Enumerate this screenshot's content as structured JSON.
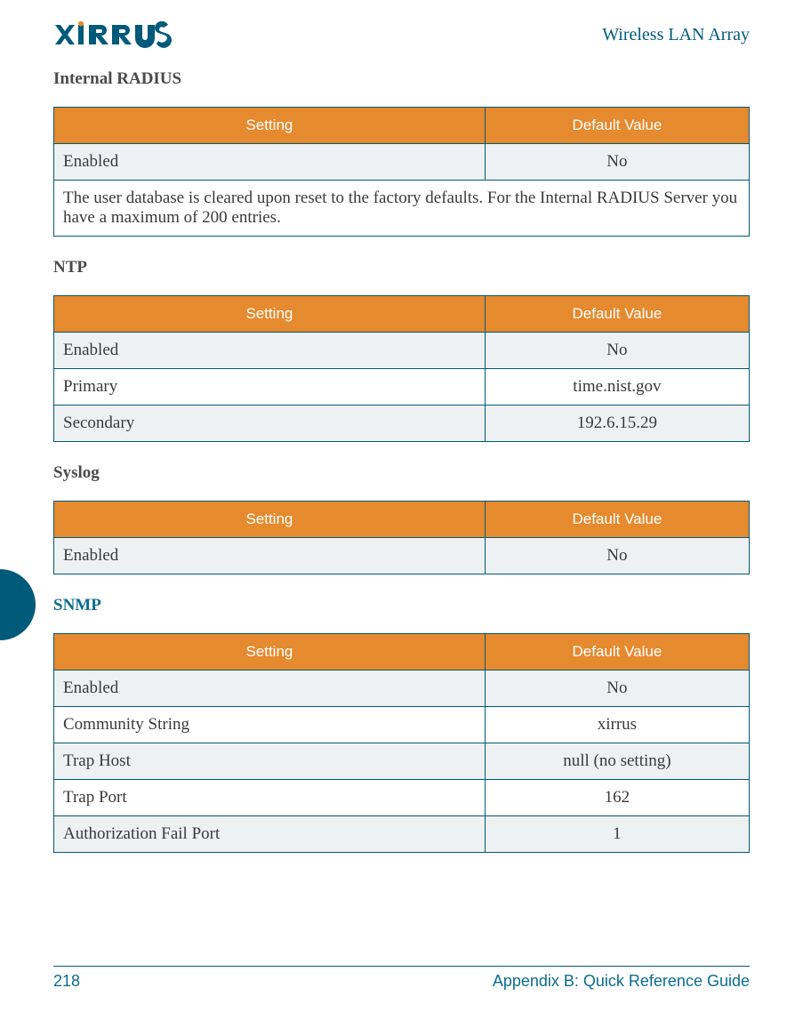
{
  "header": {
    "logo_text": "XIRRUS",
    "doc_title": "Wireless LAN Array"
  },
  "sections": {
    "internal_radius": {
      "heading": "Internal RADIUS",
      "columns": {
        "setting": "Setting",
        "value": "Default Value"
      },
      "rows": [
        {
          "setting": "Enabled",
          "value": "No"
        }
      ],
      "note": "The user database is cleared upon reset to the factory defaults. For the Internal RADIUS Server you have a maximum of 200 entries."
    },
    "ntp": {
      "heading": "NTP",
      "columns": {
        "setting": "Setting",
        "value": "Default Value"
      },
      "rows": [
        {
          "setting": "Enabled",
          "value": "No"
        },
        {
          "setting": "Primary",
          "value": "time.nist.gov"
        },
        {
          "setting": "Secondary",
          "value": "192.6.15.29"
        }
      ]
    },
    "syslog": {
      "heading": "Syslog",
      "columns": {
        "setting": "Setting",
        "value": "Default Value"
      },
      "rows": [
        {
          "setting": "Enabled",
          "value": "No"
        }
      ]
    },
    "snmp": {
      "heading": "SNMP",
      "columns": {
        "setting": "Setting",
        "value": "Default Value"
      },
      "rows": [
        {
          "setting": "Enabled",
          "value": "No"
        },
        {
          "setting": "Community String",
          "value": "xirrus"
        },
        {
          "setting": "Trap Host",
          "value": "null (no setting)"
        },
        {
          "setting": "Trap Port",
          "value": "162"
        },
        {
          "setting": "Authorization Fail Port",
          "value": "1"
        }
      ]
    }
  },
  "footer": {
    "page_number": "218",
    "appendix": "Appendix B: Quick Reference Guide"
  }
}
